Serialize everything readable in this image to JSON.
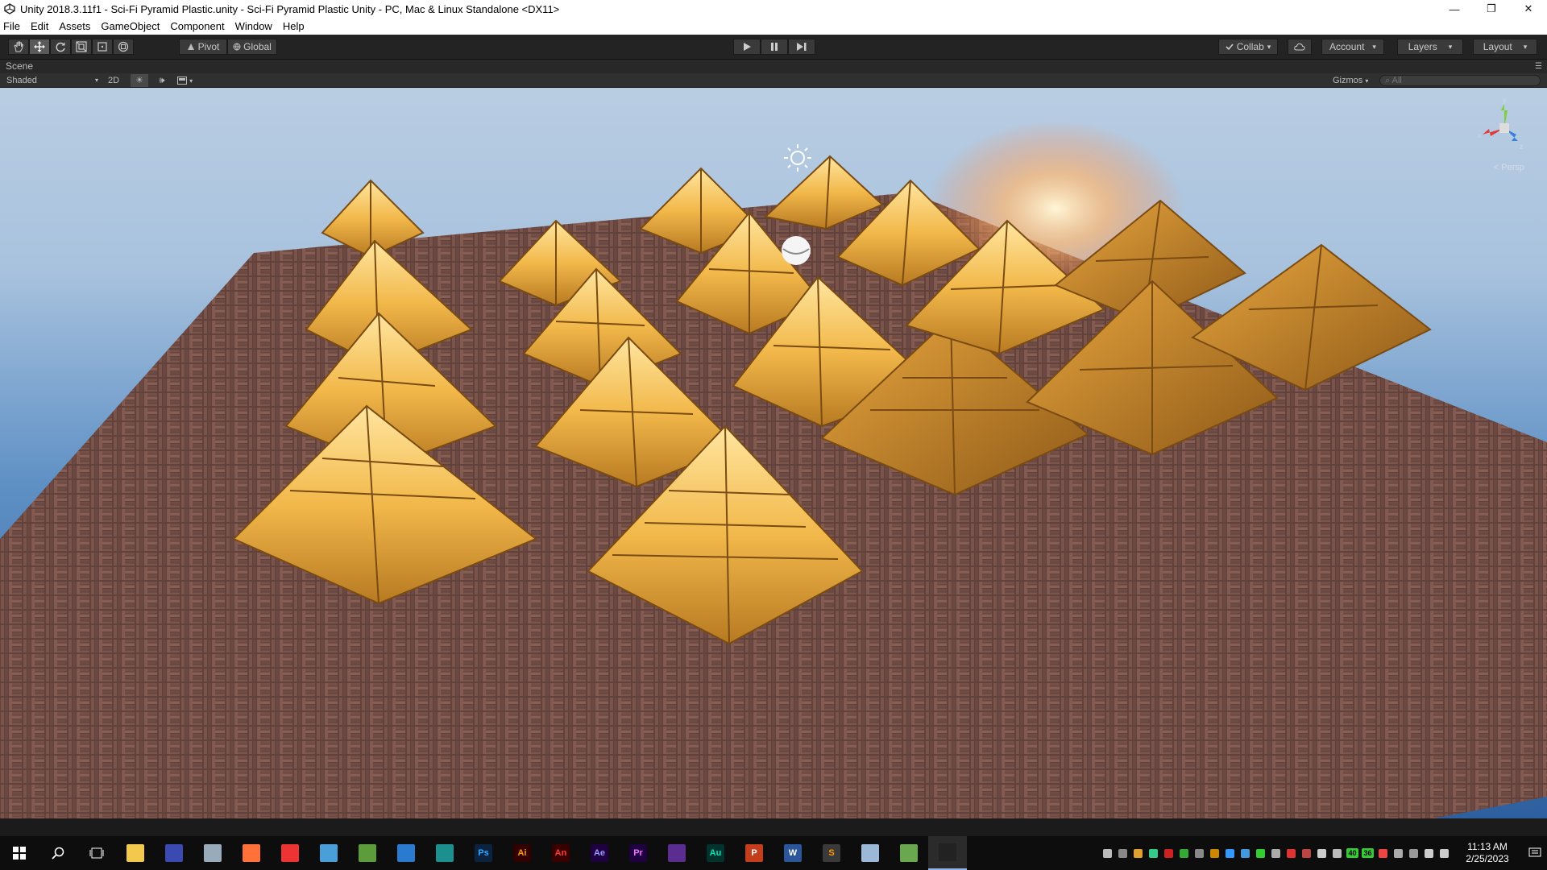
{
  "window": {
    "title": "Unity 2018.3.11f1 - Sci-Fi Pyramid Plastic.unity - Sci-Fi Pyramid Plastic Unity - PC, Mac & Linux Standalone <DX11>",
    "minimize_glyph": "—",
    "maximize_glyph": "❐",
    "close_glyph": "✕"
  },
  "menu": {
    "items": [
      "File",
      "Edit",
      "Assets",
      "GameObject",
      "Component",
      "Window",
      "Help"
    ]
  },
  "toolbar": {
    "pivot_label": "Pivot",
    "global_label": "Global",
    "collab_label": "Collab",
    "account_label": "Account",
    "layers_label": "Layers",
    "layout_label": "Layout",
    "dropdown_glyph": "▾"
  },
  "scene": {
    "tab_label": "Scene",
    "draw_mode": "Shaded",
    "mode_2d": "2D",
    "gizmos_label": "Gizmos",
    "search_placeholder": "All",
    "persp_label": "< Persp",
    "axis_x": "x",
    "axis_y": "y",
    "axis_z": "z"
  },
  "taskbar": {
    "apps": [
      {
        "name": "file-explorer",
        "color": "#f2c94c",
        "text": ""
      },
      {
        "name": "unity-hub",
        "color": "#3b4ab0",
        "text": ""
      },
      {
        "name": "paint",
        "color": "#9ab",
        "text": ""
      },
      {
        "name": "firefox",
        "color": "#ff7139",
        "text": ""
      },
      {
        "name": "chrome",
        "color": "#e33",
        "text": ""
      },
      {
        "name": "search-tool",
        "color": "#4a9fd8",
        "text": ""
      },
      {
        "name": "globe-app",
        "color": "#5c9c3a",
        "text": ""
      },
      {
        "name": "earth-app",
        "color": "#2a7bd0",
        "text": ""
      },
      {
        "name": "maya",
        "color": "#1c8f8f",
        "text": ""
      },
      {
        "name": "photoshop",
        "color": "#0b2340",
        "text": "Ps",
        "fg": "#31a8ff"
      },
      {
        "name": "illustrator",
        "color": "#330000",
        "text": "Ai",
        "fg": "#ff9a00"
      },
      {
        "name": "animate",
        "color": "#3a0000",
        "text": "An",
        "fg": "#ff3b3b"
      },
      {
        "name": "after-effects",
        "color": "#1f0040",
        "text": "Ae",
        "fg": "#9999ff"
      },
      {
        "name": "premiere",
        "color": "#1f0040",
        "text": "Pr",
        "fg": "#ea77ff"
      },
      {
        "name": "visual-studio",
        "color": "#5c2d91",
        "text": "",
        "fg": "#fff"
      },
      {
        "name": "audition",
        "color": "#00332e",
        "text": "Au",
        "fg": "#00e4bb"
      },
      {
        "name": "powerpoint",
        "color": "#c43e1c",
        "text": "P",
        "fg": "#fff"
      },
      {
        "name": "word",
        "color": "#2b579a",
        "text": "W",
        "fg": "#fff"
      },
      {
        "name": "sublime",
        "color": "#3a3a3a",
        "text": "S",
        "fg": "#ff9800"
      },
      {
        "name": "notepad",
        "color": "#9bb8d8",
        "text": "",
        "fg": "#fff"
      },
      {
        "name": "network-app",
        "color": "#6aa84f",
        "text": "",
        "fg": "#fff"
      },
      {
        "name": "unity-editor",
        "color": "#222",
        "text": "",
        "fg": "#fff",
        "active": true
      }
    ],
    "tray_colors": [
      "#bbb",
      "#888",
      "#e0a030",
      "#3c8",
      "#c22",
      "#3a3",
      "#888",
      "#c80",
      "#39f",
      "#49d",
      "#3c3",
      "#aaa",
      "#d33",
      "#b44",
      "#ccc",
      "#bbb",
      "#3c3",
      "#3c3",
      "#e44",
      "#aaa",
      "#999",
      "#ccc",
      "#ccc"
    ],
    "tray_badges": {
      "16": "40",
      "17": "36"
    },
    "time": "11:13 AM",
    "date": "2/25/2023"
  }
}
